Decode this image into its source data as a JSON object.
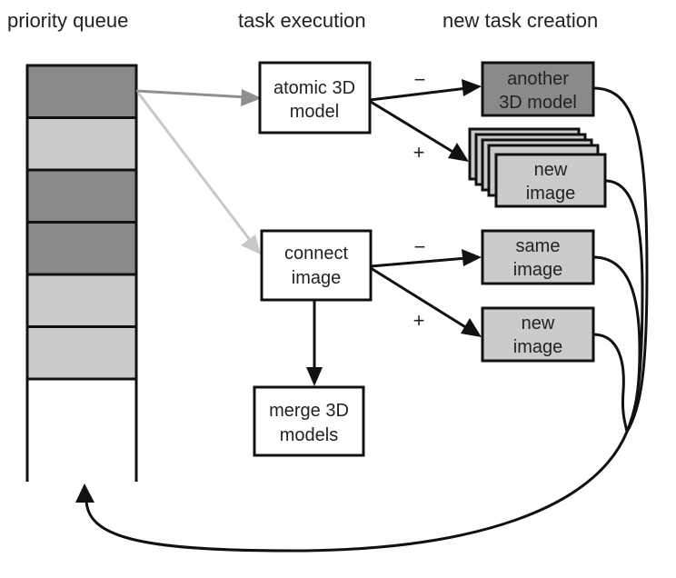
{
  "headers": {
    "queue": "priority queue",
    "execution": "task execution",
    "creation": "new task creation"
  },
  "queue": {
    "cells": [
      "dark",
      "light",
      "dark",
      "dark",
      "light",
      "light"
    ]
  },
  "colors": {
    "dark": "#8a8a8a",
    "light": "#cbcbcb",
    "arrow_gray": "#8f8f8f",
    "arrow_light": "#c8c8c8",
    "stroke": "#111111"
  },
  "tasks": {
    "atomic": [
      "atomic 3D",
      "model"
    ],
    "connect": [
      "connect",
      "image"
    ],
    "merge": [
      "merge 3D",
      "models"
    ]
  },
  "outputs": {
    "another_model": [
      "another",
      "3D model"
    ],
    "new_image_stack": [
      "new",
      "image"
    ],
    "same_image": [
      "same",
      "image"
    ],
    "new_image": [
      "new",
      "image"
    ]
  },
  "signs": {
    "minus": "−",
    "plus": "+"
  }
}
